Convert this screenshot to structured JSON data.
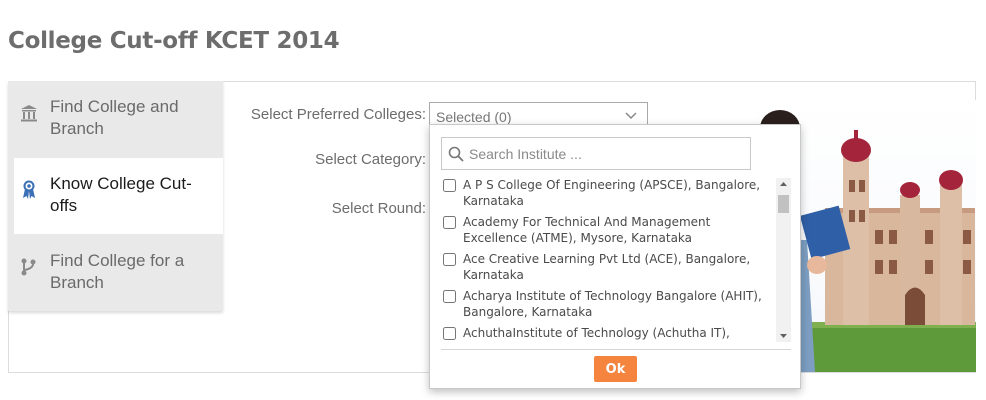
{
  "page": {
    "title": "College Cut-off KCET 2014"
  },
  "sidebar": {
    "items": [
      {
        "label": "Find College and Branch",
        "icon": "institution-icon",
        "active": false
      },
      {
        "label": "Know College Cut-offs",
        "icon": "award-ribbon-icon",
        "active": true
      },
      {
        "label": "Find College for a Branch",
        "icon": "branch-fork-icon",
        "active": false
      }
    ]
  },
  "form": {
    "colleges_label": "Select Preferred Colleges:",
    "category_label": "Select Category:",
    "round_label": "Select Round:",
    "colleges_select_value": "Selected (0)"
  },
  "dropdown": {
    "search_placeholder": "Search Institute ...",
    "options": [
      "A P S College Of Engineering (APSCE), Bangalore, Karnataka",
      "Academy For Technical And Management Excellence (ATME), Mysore, Karnataka",
      "Ace Creative Learning Pvt Ltd (ACE), Bangalore, Karnataka",
      "Acharya Institute of Technology Bangalore (AHIT), Bangalore, Karnataka",
      "AchuthaInstitute of Technology (Achutha IT),"
    ],
    "ok_label": "Ok"
  },
  "colors": {
    "accent_button": "#f5843e",
    "active_icon": "#3b6fb6",
    "sidebar_bg": "#e9e9e9"
  }
}
